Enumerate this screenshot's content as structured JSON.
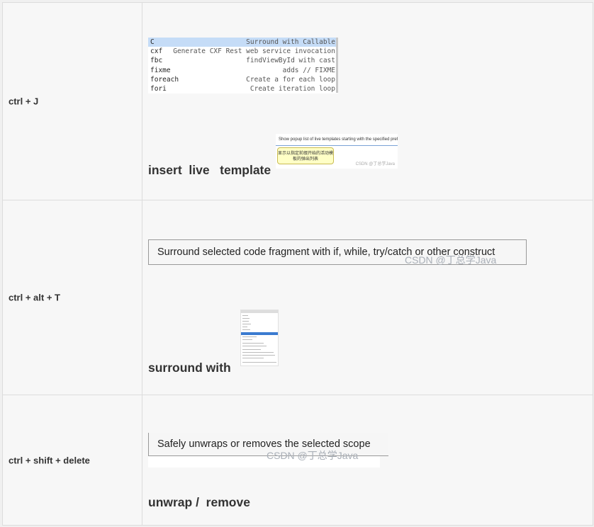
{
  "rows": [
    {
      "shortcut": "ctrl  +  J",
      "caption": "insert  live   template",
      "popup": [
        {
          "abbr": "C",
          "desc": "Surround with Callable",
          "selected": true
        },
        {
          "abbr": "cxf",
          "desc": "Generate CXF Rest web service invocation",
          "selected": false
        },
        {
          "abbr": "fbc",
          "desc": "findViewById with cast",
          "selected": false
        },
        {
          "abbr": "fixme",
          "desc": "adds // FIXME",
          "selected": false
        },
        {
          "abbr": "foreach",
          "desc": "Create a for each loop",
          "selected": false
        },
        {
          "abbr": "fori",
          "desc": "Create iteration loop",
          "selected": false
        }
      ],
      "hint_text": "Show popup list of live templates starting with the specified prefix",
      "hint_bubble": "显示以指定前缀开始的活动模板的弹出列表",
      "hint_watermark": "CSDN @丁总学Java"
    },
    {
      "shortcut": "ctrl + alt + T",
      "caption": "surround with",
      "tooltip": "Surround selected code fragment with if, while, try/catch or other construct",
      "watermark": "CSDN @丁总学Java"
    },
    {
      "shortcut": "ctrl + shift + delete",
      "caption": "unwrap /  remove",
      "tooltip": "Safely unwraps or removes the selected scope",
      "watermark": "CSDN @丁总学Java"
    }
  ]
}
